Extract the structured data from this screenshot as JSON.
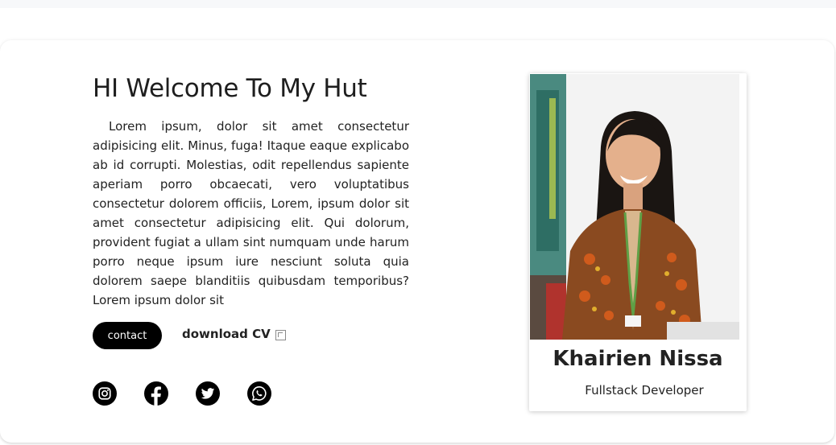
{
  "hero": {
    "title": "HI Welcome To My Hut",
    "paragraph": "Lorem ipsum, dolor sit amet consectetur adipisicing elit. Minus, fuga! Itaque eaque explicabo ab id corrupti. Molestias, odit repellendus sapiente aperiam porro obcaecati, vero voluptatibus consectetur dolorem officiis, Lorem, ipsum dolor sit amet consectetur adipisicing elit. Qui dolorum, provident fugiat a ullam sint numquam unde harum porro neque ipsum iure nesciunt soluta quia dolorem saepe blanditiis quibusdam temporibus? Lorem ipsum dolor sit",
    "contact_label": "contact",
    "download_label": "download CV",
    "download_icon": "broken-image-icon"
  },
  "socials": [
    {
      "icon": "instagram-icon"
    },
    {
      "icon": "facebook-icon"
    },
    {
      "icon": "twitter-icon"
    },
    {
      "icon": "whatsapp-icon"
    }
  ],
  "profile": {
    "name": "Khairien Nissa",
    "role": "Fullstack Developer"
  },
  "colors": {
    "button_bg": "#000000",
    "button_text": "#ffffff",
    "social_bg": "#000000"
  }
}
